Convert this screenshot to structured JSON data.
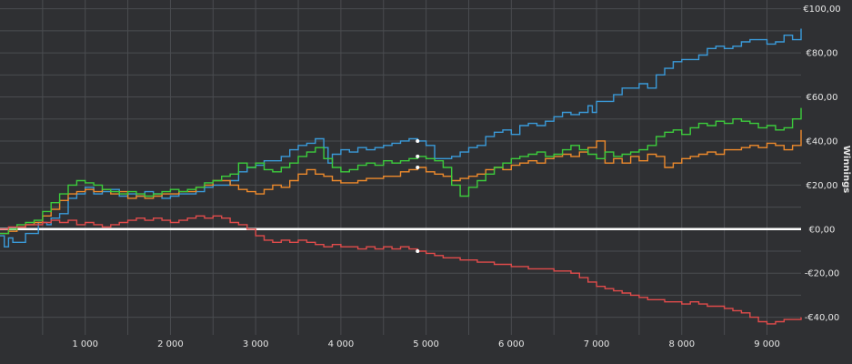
{
  "chart_data": {
    "type": "line",
    "title": "",
    "xlabel": "",
    "ylabel": "Winnings",
    "xlim": [
      0,
      9400
    ],
    "ylim": [
      -48,
      104
    ],
    "grid": true,
    "legend": "none",
    "x_ticks": [
      {
        "value": 1000,
        "label": "1 000"
      },
      {
        "value": 2000,
        "label": "2 000"
      },
      {
        "value": 3000,
        "label": "3 000"
      },
      {
        "value": 4000,
        "label": "4 000"
      },
      {
        "value": 5000,
        "label": "5 000"
      },
      {
        "value": 6000,
        "label": "6 000"
      },
      {
        "value": 7000,
        "label": "7 000"
      },
      {
        "value": 8000,
        "label": "8 000"
      },
      {
        "value": 9000,
        "label": "9 000"
      }
    ],
    "y_ticks": [
      {
        "value": 100,
        "label": "€100,00"
      },
      {
        "value": 80,
        "label": "€80,00"
      },
      {
        "value": 60,
        "label": "€60,00"
      },
      {
        "value": 40,
        "label": "€40,00"
      },
      {
        "value": 20,
        "label": "€20,00"
      },
      {
        "value": 0,
        "label": "€0,00"
      },
      {
        "value": -20,
        "label": "-€20,00"
      },
      {
        "value": -40,
        "label": "-€40,00"
      }
    ],
    "colors": {
      "background": "#2f3033",
      "grid": "#4a4c50",
      "zero_line": "#ffffff",
      "text": "#e6e6e6"
    },
    "hover_x": 4900,
    "series": [
      {
        "color": "#3a9ad9",
        "x": [
          0,
          50,
          100,
          150,
          300,
          450,
          550,
          600,
          700,
          800,
          900,
          1000,
          1100,
          1200,
          1300,
          1400,
          1500,
          1600,
          1700,
          1800,
          1900,
          2000,
          2100,
          2200,
          2300,
          2400,
          2500,
          2600,
          2700,
          2800,
          2900,
          3000,
          3100,
          3200,
          3300,
          3400,
          3500,
          3600,
          3700,
          3800,
          3850,
          3900,
          4000,
          4100,
          4200,
          4300,
          4400,
          4500,
          4600,
          4700,
          4800,
          4900,
          5000,
          5100,
          5200,
          5300,
          5400,
          5500,
          5600,
          5700,
          5800,
          5900,
          6000,
          6100,
          6200,
          6300,
          6400,
          6500,
          6600,
          6700,
          6800,
          6900,
          6950,
          7000,
          7100,
          7200,
          7300,
          7400,
          7500,
          7600,
          7700,
          7800,
          7900,
          8000,
          8100,
          8200,
          8300,
          8400,
          8500,
          8600,
          8700,
          8800,
          8900,
          9000,
          9100,
          9200,
          9300,
          9400
        ],
        "y": [
          -3,
          -8,
          -4,
          -6,
          -2,
          3,
          2,
          5,
          7,
          14,
          16,
          19,
          16,
          17,
          18,
          15,
          16,
          15,
          17,
          16,
          14,
          15,
          16,
          16,
          17,
          19,
          20,
          20,
          22,
          26,
          28,
          29,
          31,
          31,
          33,
          36,
          38,
          39,
          41,
          37,
          30,
          34,
          36,
          35,
          37,
          36,
          37,
          38,
          39,
          40,
          41,
          40,
          38,
          32,
          32,
          33,
          35,
          37,
          38,
          42,
          44,
          45,
          43,
          47,
          48,
          47,
          49,
          51,
          53,
          52,
          53,
          56,
          53,
          58,
          58,
          61,
          64,
          64,
          66,
          64,
          70,
          73,
          76,
          77,
          77,
          79,
          82,
          83,
          82,
          83,
          85,
          86,
          86,
          84,
          85,
          88,
          86,
          91
        ]
      },
      {
        "color": "#ee8a2c",
        "x": [
          0,
          100,
          200,
          300,
          400,
          500,
          600,
          700,
          800,
          900,
          1000,
          1100,
          1200,
          1300,
          1400,
          1500,
          1600,
          1700,
          1800,
          1900,
          2000,
          2100,
          2200,
          2300,
          2400,
          2500,
          2600,
          2700,
          2800,
          2900,
          3000,
          3100,
          3200,
          3300,
          3400,
          3500,
          3600,
          3700,
          3800,
          3900,
          4000,
          4100,
          4200,
          4300,
          4400,
          4500,
          4600,
          4700,
          4800,
          4900,
          5000,
          5100,
          5200,
          5300,
          5400,
          5500,
          5600,
          5700,
          5800,
          5900,
          6000,
          6100,
          6200,
          6300,
          6400,
          6500,
          6600,
          6700,
          6800,
          6900,
          7000,
          7100,
          7200,
          7300,
          7400,
          7500,
          7600,
          7700,
          7800,
          7900,
          8000,
          8100,
          8200,
          8300,
          8400,
          8500,
          8600,
          8700,
          8800,
          8900,
          9000,
          9100,
          9200,
          9300,
          9400
        ],
        "y": [
          -2,
          -1,
          1,
          2,
          3,
          6,
          9,
          13,
          16,
          17,
          18,
          17,
          18,
          16,
          17,
          14,
          15,
          14,
          15,
          16,
          16,
          17,
          17,
          19,
          20,
          22,
          22,
          20,
          18,
          17,
          16,
          18,
          20,
          19,
          22,
          25,
          27,
          25,
          24,
          22,
          21,
          21,
          22,
          23,
          23,
          24,
          24,
          26,
          27,
          28,
          26,
          25,
          24,
          22,
          23,
          24,
          25,
          27,
          28,
          27,
          29,
          30,
          31,
          30,
          32,
          33,
          34,
          33,
          35,
          37,
          40,
          30,
          32,
          30,
          33,
          31,
          34,
          33,
          28,
          30,
          32,
          33,
          34,
          35,
          34,
          36,
          36,
          37,
          38,
          37,
          39,
          38,
          36,
          38,
          45
        ]
      },
      {
        "color": "#3ccc3c",
        "x": [
          0,
          100,
          200,
          300,
          400,
          500,
          600,
          700,
          800,
          900,
          1000,
          1100,
          1200,
          1300,
          1400,
          1500,
          1600,
          1700,
          1800,
          1900,
          2000,
          2100,
          2200,
          2300,
          2400,
          2500,
          2600,
          2700,
          2800,
          2900,
          3000,
          3100,
          3200,
          3300,
          3400,
          3500,
          3600,
          3700,
          3800,
          3900,
          4000,
          4100,
          4200,
          4300,
          4400,
          4500,
          4600,
          4700,
          4800,
          4900,
          5000,
          5100,
          5200,
          5300,
          5400,
          5500,
          5600,
          5700,
          5800,
          5900,
          6000,
          6100,
          6200,
          6300,
          6400,
          6500,
          6600,
          6700,
          6800,
          6900,
          7000,
          7100,
          7200,
          7300,
          7400,
          7500,
          7600,
          7700,
          7800,
          7900,
          8000,
          8100,
          8200,
          8300,
          8400,
          8500,
          8600,
          8700,
          8800,
          8900,
          9000,
          9100,
          9200,
          9300,
          9400
        ],
        "y": [
          -2,
          0,
          2,
          3,
          4,
          8,
          12,
          16,
          20,
          22,
          21,
          20,
          18,
          17,
          16,
          17,
          16,
          15,
          16,
          17,
          18,
          17,
          18,
          19,
          21,
          22,
          24,
          25,
          30,
          28,
          30,
          27,
          26,
          28,
          30,
          33,
          35,
          37,
          32,
          28,
          26,
          27,
          29,
          30,
          29,
          31,
          30,
          31,
          32,
          33,
          32,
          31,
          28,
          20,
          15,
          19,
          22,
          25,
          28,
          30,
          32,
          33,
          34,
          35,
          33,
          34,
          36,
          38,
          36,
          34,
          32,
          35,
          33,
          34,
          35,
          36,
          38,
          42,
          44,
          45,
          43,
          46,
          48,
          47,
          49,
          48,
          50,
          49,
          48,
          46,
          47,
          45,
          46,
          50,
          55
        ]
      },
      {
        "color": "#e04b4b",
        "x": [
          0,
          100,
          200,
          300,
          400,
          500,
          600,
          700,
          800,
          900,
          1000,
          1100,
          1200,
          1300,
          1400,
          1500,
          1600,
          1700,
          1800,
          1900,
          2000,
          2100,
          2200,
          2300,
          2400,
          2500,
          2600,
          2700,
          2800,
          2900,
          3000,
          3100,
          3200,
          3300,
          3400,
          3500,
          3600,
          3700,
          3800,
          3900,
          4000,
          4100,
          4200,
          4300,
          4400,
          4500,
          4600,
          4700,
          4800,
          4900,
          5000,
          5100,
          5200,
          5300,
          5400,
          5500,
          5600,
          5700,
          5800,
          5900,
          6000,
          6100,
          6200,
          6300,
          6400,
          6500,
          6600,
          6700,
          6800,
          6900,
          7000,
          7100,
          7200,
          7300,
          7400,
          7500,
          7600,
          7700,
          7800,
          7900,
          8000,
          8100,
          8200,
          8300,
          8400,
          8500,
          8600,
          8700,
          8800,
          8900,
          9000,
          9100,
          9200,
          9300,
          9400
        ],
        "y": [
          0,
          1,
          1,
          2,
          2,
          3,
          4,
          3,
          4,
          2,
          3,
          2,
          1,
          2,
          3,
          4,
          5,
          4,
          5,
          4,
          3,
          4,
          5,
          6,
          5,
          6,
          5,
          3,
          2,
          0,
          -3,
          -5,
          -6,
          -5,
          -6,
          -5,
          -6,
          -7,
          -8,
          -7,
          -8,
          -8,
          -9,
          -8,
          -9,
          -8,
          -9,
          -8,
          -9,
          -10,
          -11,
          -12,
          -13,
          -13,
          -14,
          -14,
          -15,
          -15,
          -16,
          -16,
          -17,
          -17,
          -18,
          -18,
          -18,
          -19,
          -19,
          -20,
          -22,
          -24,
          -26,
          -27,
          -28,
          -29,
          -30,
          -31,
          -32,
          -32,
          -33,
          -33,
          -34,
          -33,
          -34,
          -35,
          -35,
          -36,
          -37,
          -38,
          -40,
          -42,
          -43,
          -42,
          -41,
          -41,
          -40
        ]
      }
    ]
  }
}
